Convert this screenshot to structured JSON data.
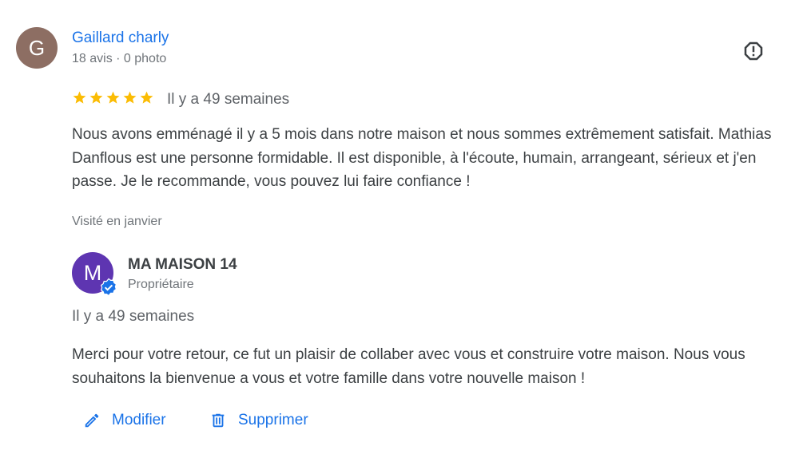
{
  "review": {
    "avatar_letter": "G",
    "reviewer_name": "Gaillard charly",
    "reviewer_meta": "18 avis · 0 photo",
    "rating": 5,
    "time": "Il y a 49 semaines",
    "text": "Nous avons emménagé il y a 5 mois dans notre maison et nous sommes extrêmement satisfait. Mathias Danflous est une personne formidable. Il est disponible, à l'écoute, humain, arrangeant, sérieux et j'en passe. Je le recommande, vous pouvez lui faire confiance !",
    "visited": "Visité en janvier"
  },
  "owner_reply": {
    "avatar_letter": "M",
    "name": "MA MAISON 14",
    "role": "Propriétaire",
    "time": "Il y a 49 semaines",
    "text": "Merci pour votre retour, ce fut un plaisir de collaber avec vous et construire votre maison. Nous vous souhaitons la bienvenue a vous et votre famille dans votre nouvelle maison !"
  },
  "actions": {
    "edit_label": "Modifier",
    "delete_label": "Supprimer"
  },
  "colors": {
    "accent": "#1a73e8",
    "star": "#fbbc04",
    "reviewer_avatar": "#8d6e63",
    "owner_avatar": "#5e35b1"
  },
  "icons": [
    "report-icon",
    "star-icon",
    "verified-badge-icon",
    "pencil-icon",
    "trash-icon"
  ]
}
